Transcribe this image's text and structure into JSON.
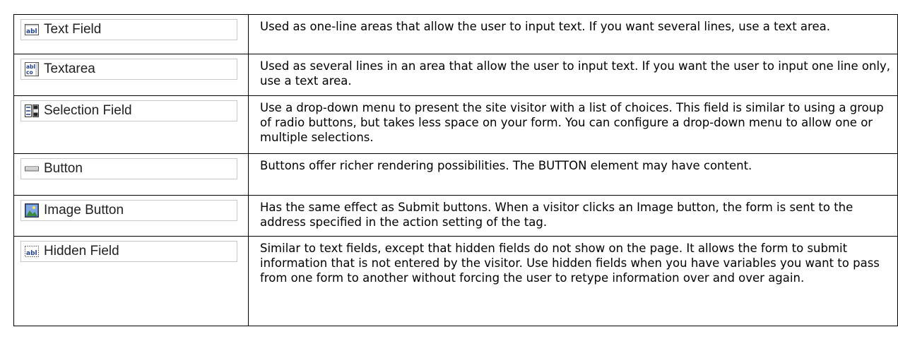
{
  "rows": [
    {
      "name": "Text Field",
      "icon": "text-field-icon",
      "description": "Used as one-line areas that allow the user to input text. If you want several lines, use a text area."
    },
    {
      "name": "Textarea",
      "icon": "textarea-icon",
      "description": "Used as several lines in an area that allow the user to input text. If you want the user to input one line only, use a text area."
    },
    {
      "name": "Selection Field",
      "icon": "selection-field-icon",
      "description": "Use a drop-down menu to present the site visitor with a list of choices. This field is similar to using a group of radio buttons, but takes less space on your form. You can configure a drop-down menu to allow one or multiple selections."
    },
    {
      "name": "Button",
      "icon": "button-icon",
      "description": "Buttons offer richer rendering possibilities. The BUTTON element may have content."
    },
    {
      "name": "Image Button",
      "icon": "image-button-icon",
      "description": "Has the same effect as Submit buttons. When a visitor clicks an Image button, the form is sent to the address specified in the action setting of the tag."
    },
    {
      "name": "Hidden Field",
      "icon": "hidden-field-icon",
      "description": "Similar to text fields, except that hidden fields do not show on the page. It allows the form to submit information that is not entered by the visitor. Use hidden fields when you have variables you want to pass from one form to another without forcing the user to retype information over and over again."
    }
  ],
  "colors": {
    "border": "#000000",
    "chip_border": "#c8c8c8",
    "icon_blue": "#1f3f8f",
    "text": "#000000"
  }
}
